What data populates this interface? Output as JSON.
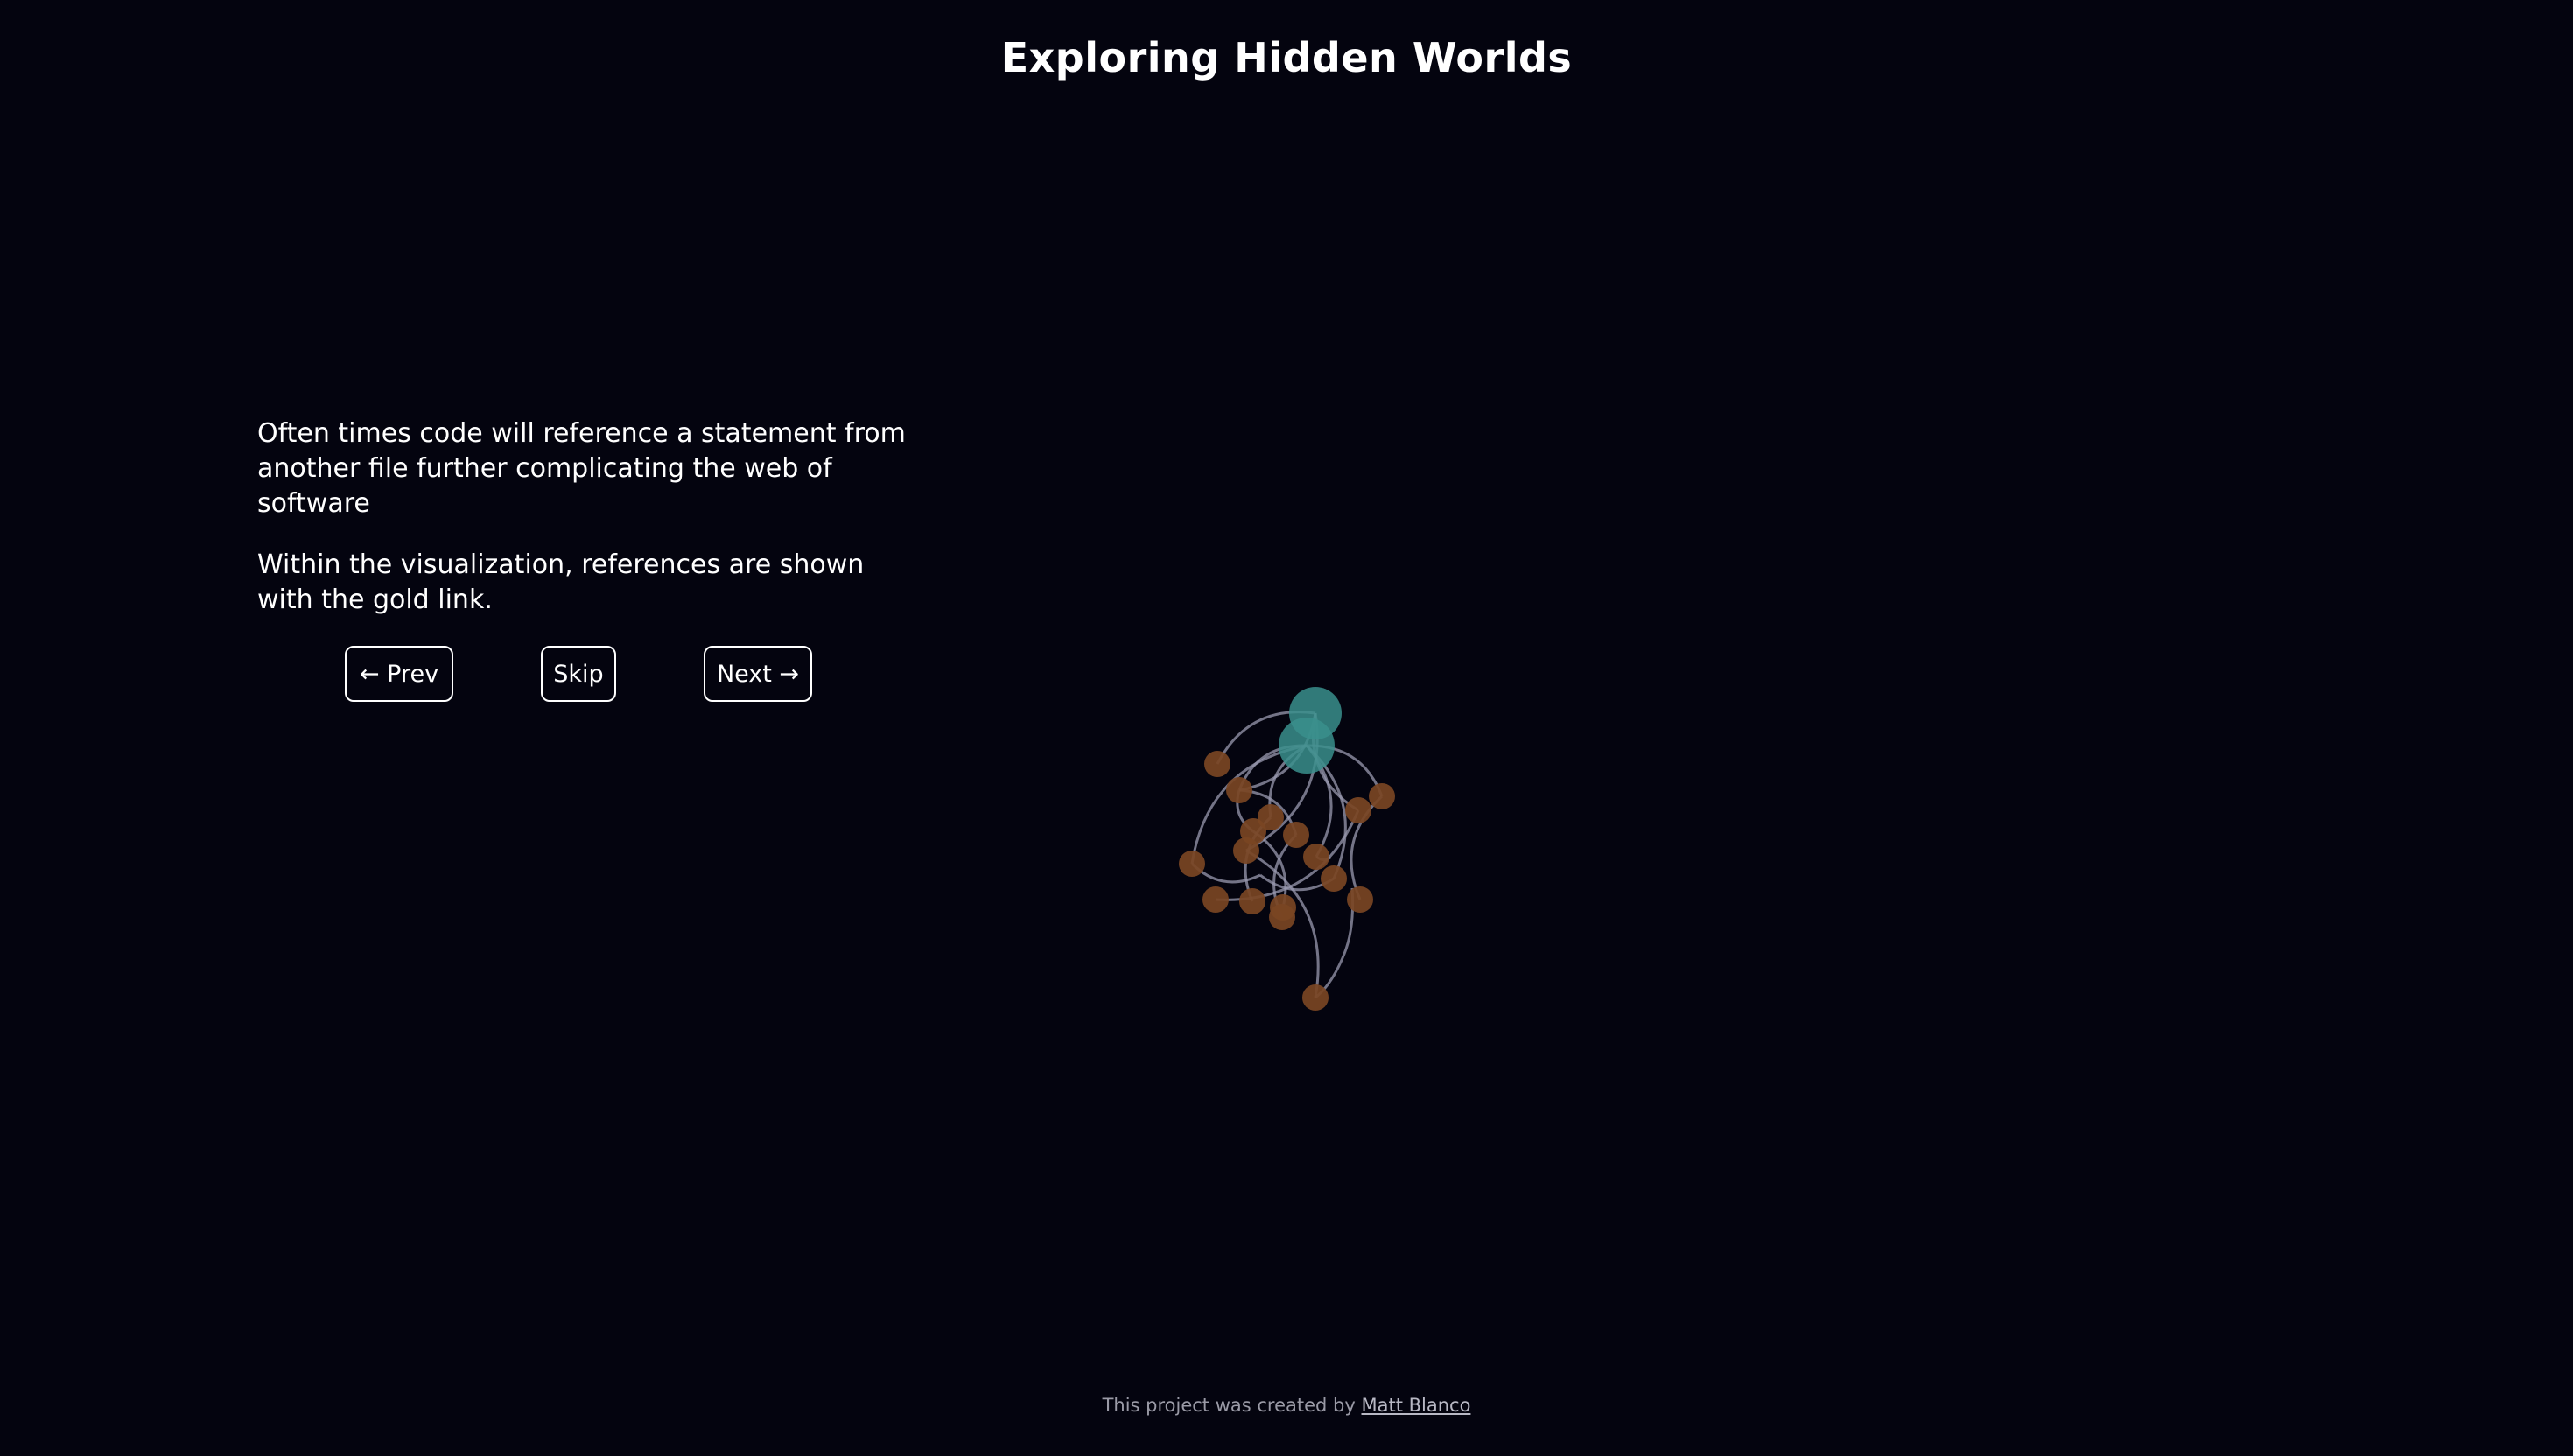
{
  "page": {
    "title": "Exploring Hidden Worlds"
  },
  "story": {
    "paragraphs": [
      "Often times code will reference a statement from another file further complicating the web of software",
      "Within the visualization, references are shown with the gold link."
    ]
  },
  "nav": {
    "prev_label": "← Prev",
    "skip_label": "Skip",
    "next_label": "Next →"
  },
  "footer": {
    "text": "This project was created by ",
    "author": "Matt Blanco"
  },
  "colors": {
    "background": "#04040f",
    "file_node": "#3a8f8c",
    "statement_node": "#7a4523",
    "link": "#9a9ab0",
    "reference_link": "#d4a640"
  },
  "graph": {
    "nodes": [
      {
        "id": "file-a",
        "kind": "file"
      },
      {
        "id": "file-b",
        "kind": "file"
      },
      {
        "id": "s1",
        "kind": "statement"
      },
      {
        "id": "s2",
        "kind": "statement"
      },
      {
        "id": "s3",
        "kind": "statement"
      },
      {
        "id": "s4",
        "kind": "statement"
      },
      {
        "id": "s5",
        "kind": "statement"
      },
      {
        "id": "s6",
        "kind": "statement"
      },
      {
        "id": "s7",
        "kind": "statement"
      },
      {
        "id": "s8",
        "kind": "statement"
      },
      {
        "id": "s9",
        "kind": "statement"
      },
      {
        "id": "s10",
        "kind": "statement"
      },
      {
        "id": "s11",
        "kind": "statement"
      },
      {
        "id": "s12",
        "kind": "statement"
      },
      {
        "id": "s13",
        "kind": "statement"
      },
      {
        "id": "s14",
        "kind": "statement"
      },
      {
        "id": "s15",
        "kind": "statement"
      },
      {
        "id": "s16",
        "kind": "statement"
      },
      {
        "id": "s17",
        "kind": "statement"
      },
      {
        "id": "s18",
        "kind": "statement"
      },
      {
        "id": "s19",
        "kind": "statement"
      }
    ],
    "links": [
      [
        "file-a",
        "s1"
      ],
      [
        "file-a",
        "s2"
      ],
      [
        "file-a",
        "s4"
      ],
      [
        "file-a",
        "s8"
      ],
      [
        "file-b",
        "s2"
      ],
      [
        "file-b",
        "s3"
      ],
      [
        "file-b",
        "s5"
      ],
      [
        "file-b",
        "s9"
      ],
      [
        "file-b",
        "s10"
      ],
      [
        "file-b",
        "s11"
      ],
      [
        "s2",
        "s6"
      ],
      [
        "s2",
        "s7"
      ],
      [
        "s3",
        "s12"
      ],
      [
        "s4",
        "s13"
      ],
      [
        "s5",
        "s14"
      ],
      [
        "s6",
        "s15"
      ],
      [
        "s7",
        "s16"
      ],
      [
        "s8",
        "s17"
      ],
      [
        "s9",
        "s18"
      ],
      [
        "s11",
        "s19"
      ],
      [
        "s10",
        "s19"
      ]
    ]
  }
}
